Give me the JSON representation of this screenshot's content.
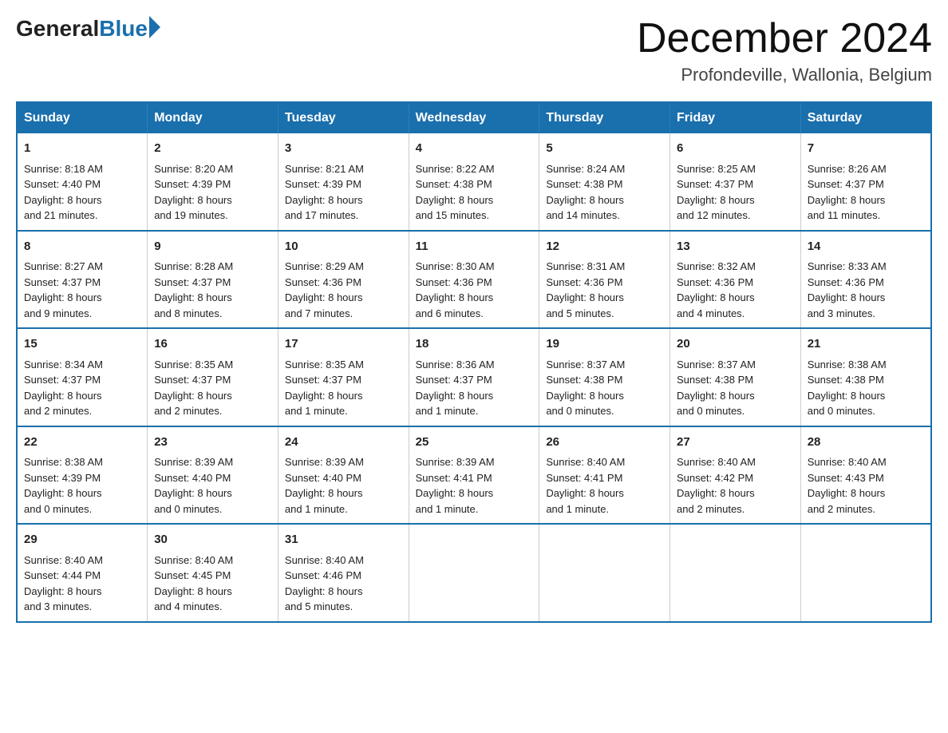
{
  "header": {
    "logo": {
      "general": "General",
      "blue": "Blue"
    },
    "title": "December 2024",
    "location": "Profondeville, Wallonia, Belgium"
  },
  "weekdays": [
    "Sunday",
    "Monday",
    "Tuesday",
    "Wednesday",
    "Thursday",
    "Friday",
    "Saturday"
  ],
  "weeks": [
    [
      {
        "day": "1",
        "sunrise": "8:18 AM",
        "sunset": "4:40 PM",
        "daylight": "8 hours and 21 minutes."
      },
      {
        "day": "2",
        "sunrise": "8:20 AM",
        "sunset": "4:39 PM",
        "daylight": "8 hours and 19 minutes."
      },
      {
        "day": "3",
        "sunrise": "8:21 AM",
        "sunset": "4:39 PM",
        "daylight": "8 hours and 17 minutes."
      },
      {
        "day": "4",
        "sunrise": "8:22 AM",
        "sunset": "4:38 PM",
        "daylight": "8 hours and 15 minutes."
      },
      {
        "day": "5",
        "sunrise": "8:24 AM",
        "sunset": "4:38 PM",
        "daylight": "8 hours and 14 minutes."
      },
      {
        "day": "6",
        "sunrise": "8:25 AM",
        "sunset": "4:37 PM",
        "daylight": "8 hours and 12 minutes."
      },
      {
        "day": "7",
        "sunrise": "8:26 AM",
        "sunset": "4:37 PM",
        "daylight": "8 hours and 11 minutes."
      }
    ],
    [
      {
        "day": "8",
        "sunrise": "8:27 AM",
        "sunset": "4:37 PM",
        "daylight": "8 hours and 9 minutes."
      },
      {
        "day": "9",
        "sunrise": "8:28 AM",
        "sunset": "4:37 PM",
        "daylight": "8 hours and 8 minutes."
      },
      {
        "day": "10",
        "sunrise": "8:29 AM",
        "sunset": "4:36 PM",
        "daylight": "8 hours and 7 minutes."
      },
      {
        "day": "11",
        "sunrise": "8:30 AM",
        "sunset": "4:36 PM",
        "daylight": "8 hours and 6 minutes."
      },
      {
        "day": "12",
        "sunrise": "8:31 AM",
        "sunset": "4:36 PM",
        "daylight": "8 hours and 5 minutes."
      },
      {
        "day": "13",
        "sunrise": "8:32 AM",
        "sunset": "4:36 PM",
        "daylight": "8 hours and 4 minutes."
      },
      {
        "day": "14",
        "sunrise": "8:33 AM",
        "sunset": "4:36 PM",
        "daylight": "8 hours and 3 minutes."
      }
    ],
    [
      {
        "day": "15",
        "sunrise": "8:34 AM",
        "sunset": "4:37 PM",
        "daylight": "8 hours and 2 minutes."
      },
      {
        "day": "16",
        "sunrise": "8:35 AM",
        "sunset": "4:37 PM",
        "daylight": "8 hours and 2 minutes."
      },
      {
        "day": "17",
        "sunrise": "8:35 AM",
        "sunset": "4:37 PM",
        "daylight": "8 hours and 1 minute."
      },
      {
        "day": "18",
        "sunrise": "8:36 AM",
        "sunset": "4:37 PM",
        "daylight": "8 hours and 1 minute."
      },
      {
        "day": "19",
        "sunrise": "8:37 AM",
        "sunset": "4:38 PM",
        "daylight": "8 hours and 0 minutes."
      },
      {
        "day": "20",
        "sunrise": "8:37 AM",
        "sunset": "4:38 PM",
        "daylight": "8 hours and 0 minutes."
      },
      {
        "day": "21",
        "sunrise": "8:38 AM",
        "sunset": "4:38 PM",
        "daylight": "8 hours and 0 minutes."
      }
    ],
    [
      {
        "day": "22",
        "sunrise": "8:38 AM",
        "sunset": "4:39 PM",
        "daylight": "8 hours and 0 minutes."
      },
      {
        "day": "23",
        "sunrise": "8:39 AM",
        "sunset": "4:40 PM",
        "daylight": "8 hours and 0 minutes."
      },
      {
        "day": "24",
        "sunrise": "8:39 AM",
        "sunset": "4:40 PM",
        "daylight": "8 hours and 1 minute."
      },
      {
        "day": "25",
        "sunrise": "8:39 AM",
        "sunset": "4:41 PM",
        "daylight": "8 hours and 1 minute."
      },
      {
        "day": "26",
        "sunrise": "8:40 AM",
        "sunset": "4:41 PM",
        "daylight": "8 hours and 1 minute."
      },
      {
        "day": "27",
        "sunrise": "8:40 AM",
        "sunset": "4:42 PM",
        "daylight": "8 hours and 2 minutes."
      },
      {
        "day": "28",
        "sunrise": "8:40 AM",
        "sunset": "4:43 PM",
        "daylight": "8 hours and 2 minutes."
      }
    ],
    [
      {
        "day": "29",
        "sunrise": "8:40 AM",
        "sunset": "4:44 PM",
        "daylight": "8 hours and 3 minutes."
      },
      {
        "day": "30",
        "sunrise": "8:40 AM",
        "sunset": "4:45 PM",
        "daylight": "8 hours and 4 minutes."
      },
      {
        "day": "31",
        "sunrise": "8:40 AM",
        "sunset": "4:46 PM",
        "daylight": "8 hours and 5 minutes."
      },
      null,
      null,
      null,
      null
    ]
  ],
  "labels": {
    "sunrise": "Sunrise:",
    "sunset": "Sunset:",
    "daylight": "Daylight:"
  }
}
